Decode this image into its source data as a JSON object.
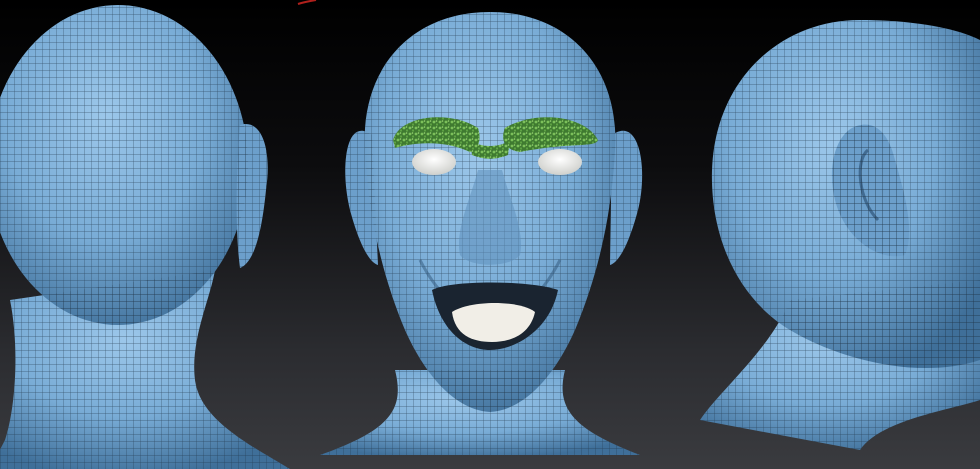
{
  "scene": {
    "views": [
      {
        "name": "back-view"
      },
      {
        "name": "front-view"
      },
      {
        "name": "side-view"
      }
    ],
    "colors": {
      "skin": "#7fb2dc",
      "skin_shadow": "#3f6f99",
      "wireframe": "#1e3448",
      "eyebrow": "#4e8f3a",
      "eyebrow_dark": "#2f5f25",
      "eye_white": "#ecebe6",
      "tongue": "#f1eee7",
      "mouth": "#1a2430",
      "bg_top": "#000000",
      "bg_bottom": "#3a3b3f"
    }
  }
}
